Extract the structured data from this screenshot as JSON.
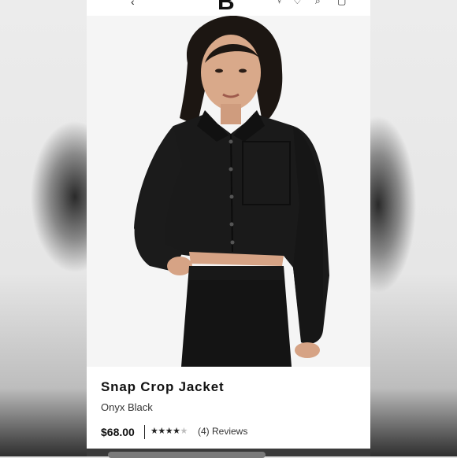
{
  "header": {
    "logo_text": "B",
    "back_icon": "back-arrow-icon",
    "icons": [
      "user-icon",
      "heart-icon",
      "search-icon",
      "bag-icon"
    ]
  },
  "product": {
    "image_alt": "Model wearing black cropped button-up jacket with matching pants",
    "name": "Snap Crop Jacket",
    "color_name": "Onyx Black",
    "price": "$68.00",
    "rating": 4,
    "rating_max": 5,
    "reviews_text": "(4) Reviews"
  },
  "colors": {
    "text": "#111111",
    "star_on": "#222222",
    "star_off": "#bdbdbd",
    "jacket": "#1a1a1a"
  }
}
